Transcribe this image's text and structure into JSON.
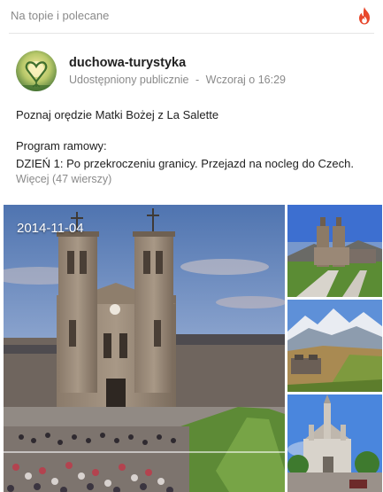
{
  "header": {
    "title": "Na topie i polecane",
    "hot_icon": "flame-icon",
    "accent": "#e8472b"
  },
  "post": {
    "author": "duchowa-turystyka",
    "visibility": "Udostępniony publicznie",
    "separator": "-",
    "timestamp": "Wczoraj o 16:29",
    "title_line": "Poznaj orędzie Matki Bożej z La Salette",
    "program_label": "Program ramowy:",
    "day1": "DZIEŃ 1: Po przekroczeniu granicy. Przejazd na nocleg do Czech.",
    "more": "Więcej (47 wierszy)"
  },
  "gallery": {
    "date": "2014-11-04",
    "main_photo": "la-salette-basilica-photo",
    "thumbnails": [
      "la-salette-basilica-thumb",
      "alpine-mountains-thumb",
      "lourdes-basilica-thumb"
    ]
  }
}
